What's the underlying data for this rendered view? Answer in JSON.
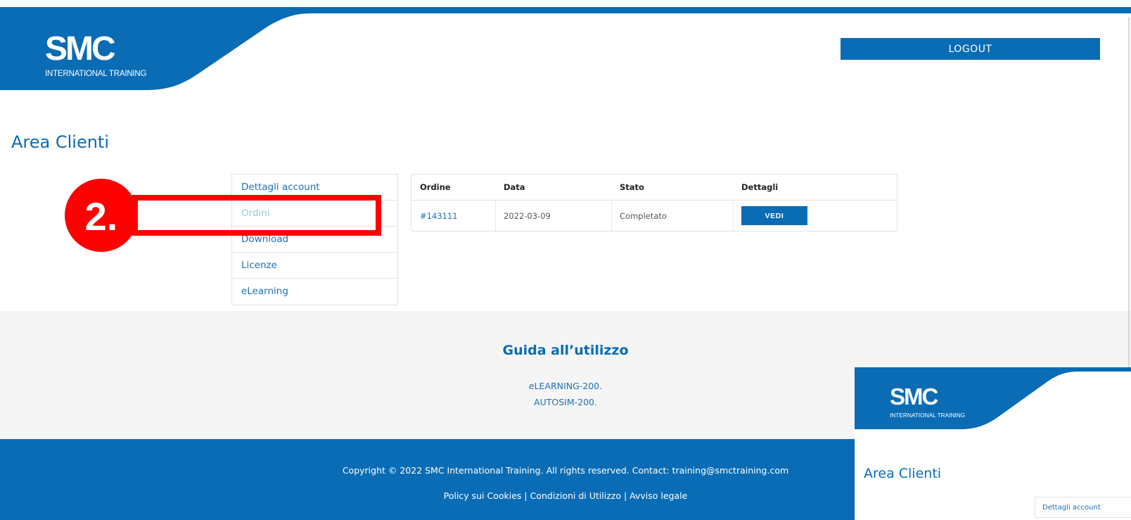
{
  "header": {
    "logo_text": "SMC",
    "logo_subtitle": "INTERNATIONAL TRAINING",
    "logout_label": "LOGOUT"
  },
  "page": {
    "title": "Area Clienti"
  },
  "account_nav": {
    "items": [
      {
        "label": "Dettagli account"
      },
      {
        "label": "Ordini"
      },
      {
        "label": "Download"
      },
      {
        "label": "Licenze"
      },
      {
        "label": "eLearning"
      }
    ]
  },
  "orders_table": {
    "headers": [
      "Ordine",
      "Data",
      "Stato",
      "Dettagli"
    ],
    "rows": [
      {
        "order": "#143111",
        "date": "2022-03-09",
        "status": "Completato",
        "action": "VEDI"
      }
    ]
  },
  "annotation": {
    "step_label": "2."
  },
  "guide": {
    "title": "Guida all’utilizzo",
    "links": [
      "eLEARNING-200.",
      "AUTOSIM-200."
    ]
  },
  "footer": {
    "copyright": "Copyright © 2022 SMC International Training. All rights reserved. Contact: training@smctraining.com",
    "links": [
      "Policy sui Cookies",
      "Condizioni di Utilizzo",
      "Avviso legale"
    ],
    "separator": "|"
  },
  "overlay_thumbnail": {
    "logo_text": "SMC",
    "logo_subtitle": "INTERNATIONAL TRAINING",
    "title": "Area Clienti",
    "nav_item": "Dettagli account"
  },
  "colors": {
    "brand_blue": "#0a6cb4",
    "link_blue": "#1e6fb8",
    "annotation_red": "#ff0000"
  }
}
